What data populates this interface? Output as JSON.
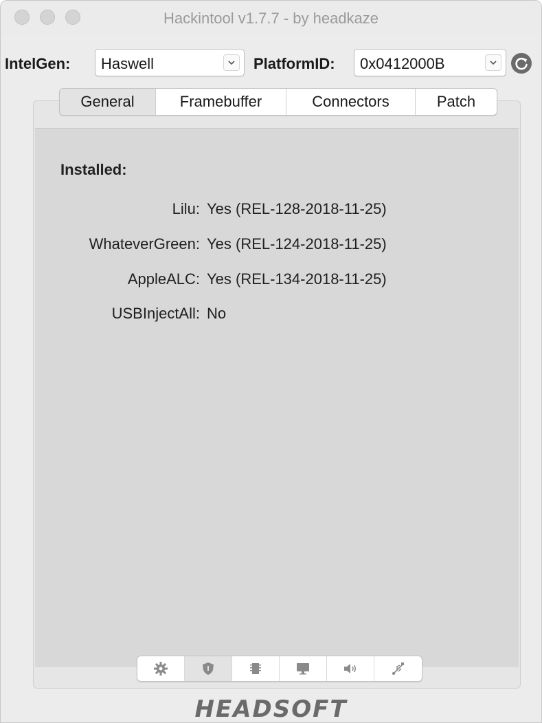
{
  "window": {
    "title": "Hackintool v1.7.7 - by headkaze"
  },
  "toolbar": {
    "intelgen_label": "IntelGen:",
    "intelgen_value": "Haswell",
    "platform_label": "PlatformID:",
    "platform_value": "0x0412000B",
    "refresh_icon": "refresh-icon"
  },
  "tabs": [
    {
      "label": "General",
      "active": true
    },
    {
      "label": "Framebuffer",
      "active": false
    },
    {
      "label": "Connectors",
      "active": false
    },
    {
      "label": "Patch",
      "active": false
    }
  ],
  "installed": {
    "title": "Installed:",
    "items": [
      {
        "key": "Lilu:",
        "value": "Yes (REL-128-2018-11-25)"
      },
      {
        "key": "WhateverGreen:",
        "value": "Yes (REL-124-2018-11-25)"
      },
      {
        "key": "AppleALC:",
        "value": "Yes (REL-134-2018-11-25)"
      },
      {
        "key": "USBInjectAll:",
        "value": "No"
      }
    ]
  },
  "bottom_bar": {
    "icons": [
      "gear-icon",
      "shield-icon",
      "chip-icon",
      "display-icon",
      "speaker-icon",
      "usb-icon"
    ],
    "active_index": 1
  },
  "footer": {
    "logo_text": "HEADSOFT"
  },
  "colors": {
    "window_bg": "#ececec",
    "pane_bg": "#d8d8d8",
    "active_segment": "#e3e3e3"
  }
}
